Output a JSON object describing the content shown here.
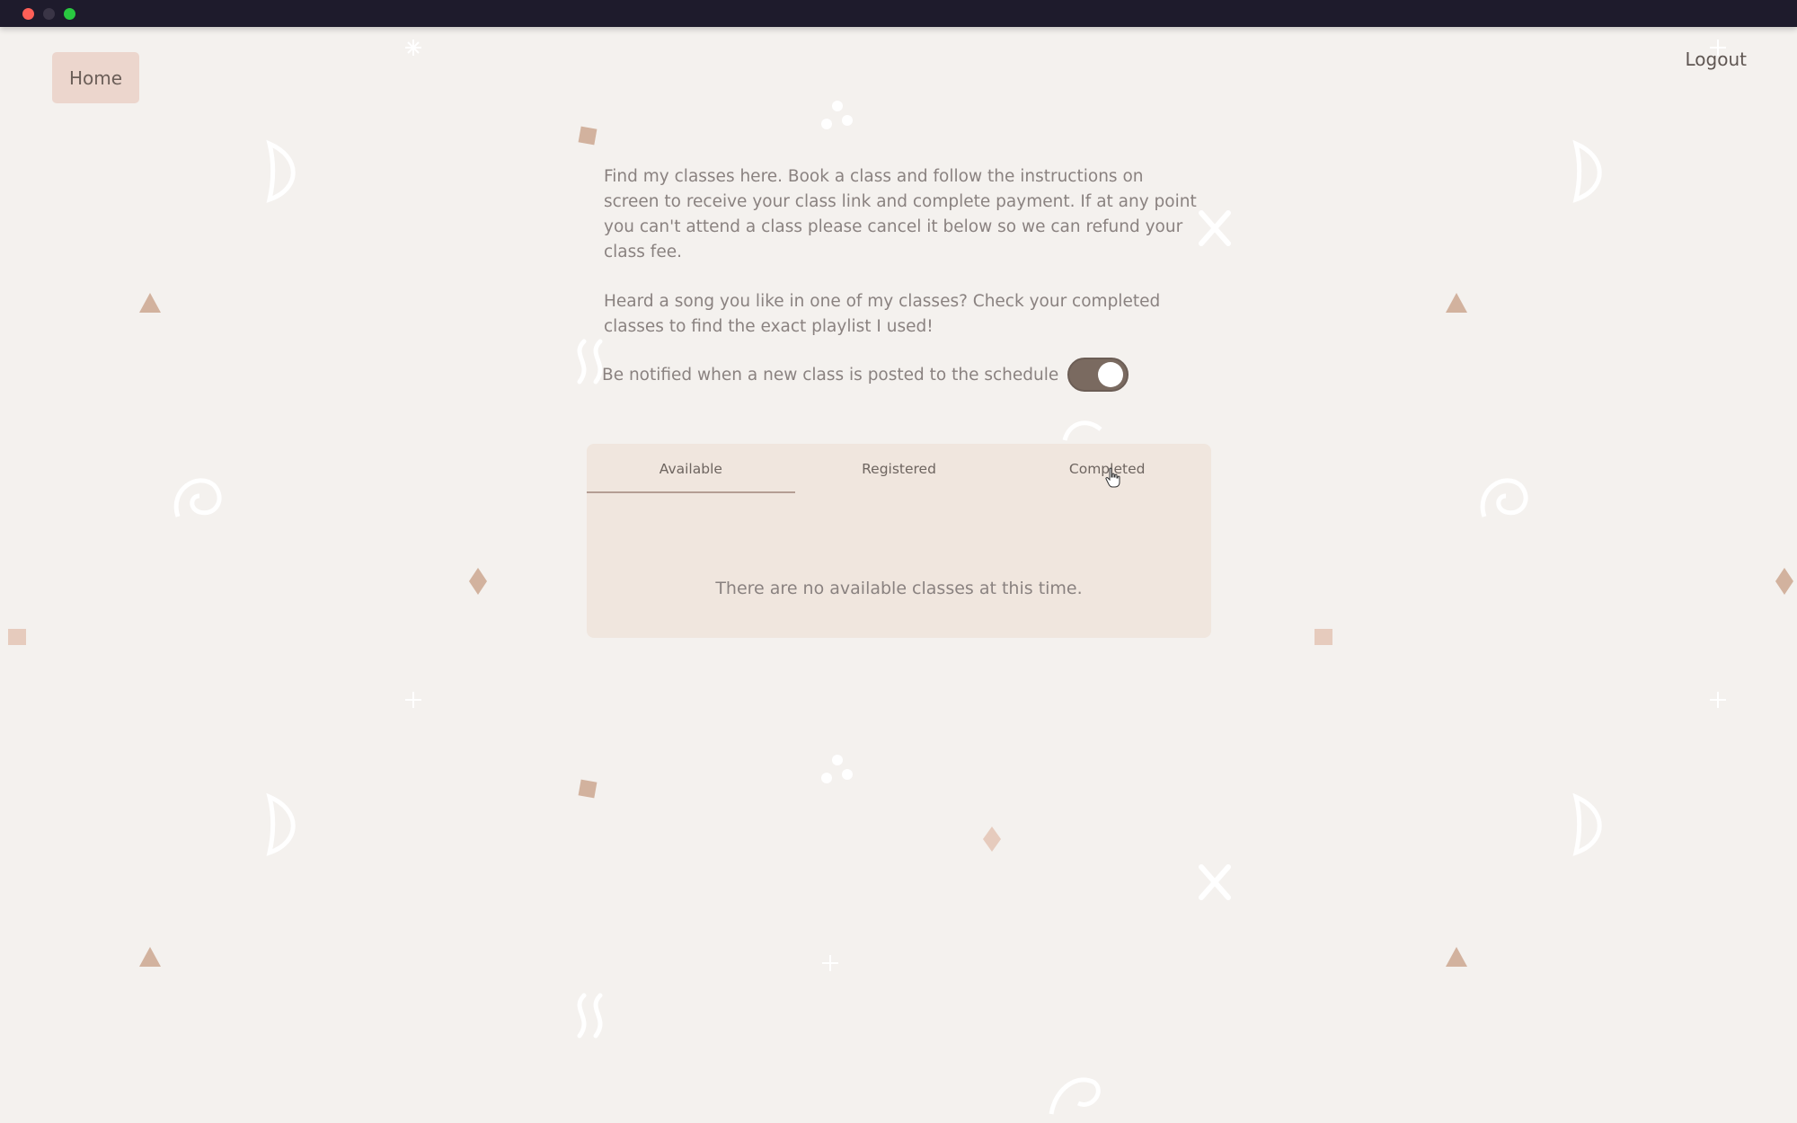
{
  "window": {
    "controls": [
      "close",
      "minimize",
      "maximize"
    ]
  },
  "nav": {
    "home_label": "Home",
    "logout_label": "Logout"
  },
  "intro": {
    "paragraph1": "Find my classes here. Book a class and follow the instructions on screen to receive your class link and complete payment. If at any point you can't attend a class please cancel it below so we can refund your class fee.",
    "paragraph2": "Heard a song you like in one of my classes? Check your completed classes to find the exact playlist I used!"
  },
  "notify": {
    "label": "Be notified when a new class is posted to the schedule",
    "enabled": true
  },
  "classes": {
    "tabs": [
      {
        "label": "Available",
        "active": true
      },
      {
        "label": "Registered",
        "active": false
      },
      {
        "label": "Completed",
        "active": false
      }
    ],
    "empty_message": "There are no available classes at this time."
  },
  "colors": {
    "background": "#f4f1ee",
    "accent": "#ecd6cd",
    "panel": "#f0e6de",
    "toggle_on": "#7a6a60",
    "shape_tan": "#d2b29e"
  },
  "icons": [
    "triangle-icon",
    "diamond-icon",
    "square-icon",
    "moon-icon",
    "swirl-icon",
    "x-icon",
    "dots-icon",
    "sparkle-icon",
    "squiggle-icon",
    "pointer-cursor-icon"
  ]
}
